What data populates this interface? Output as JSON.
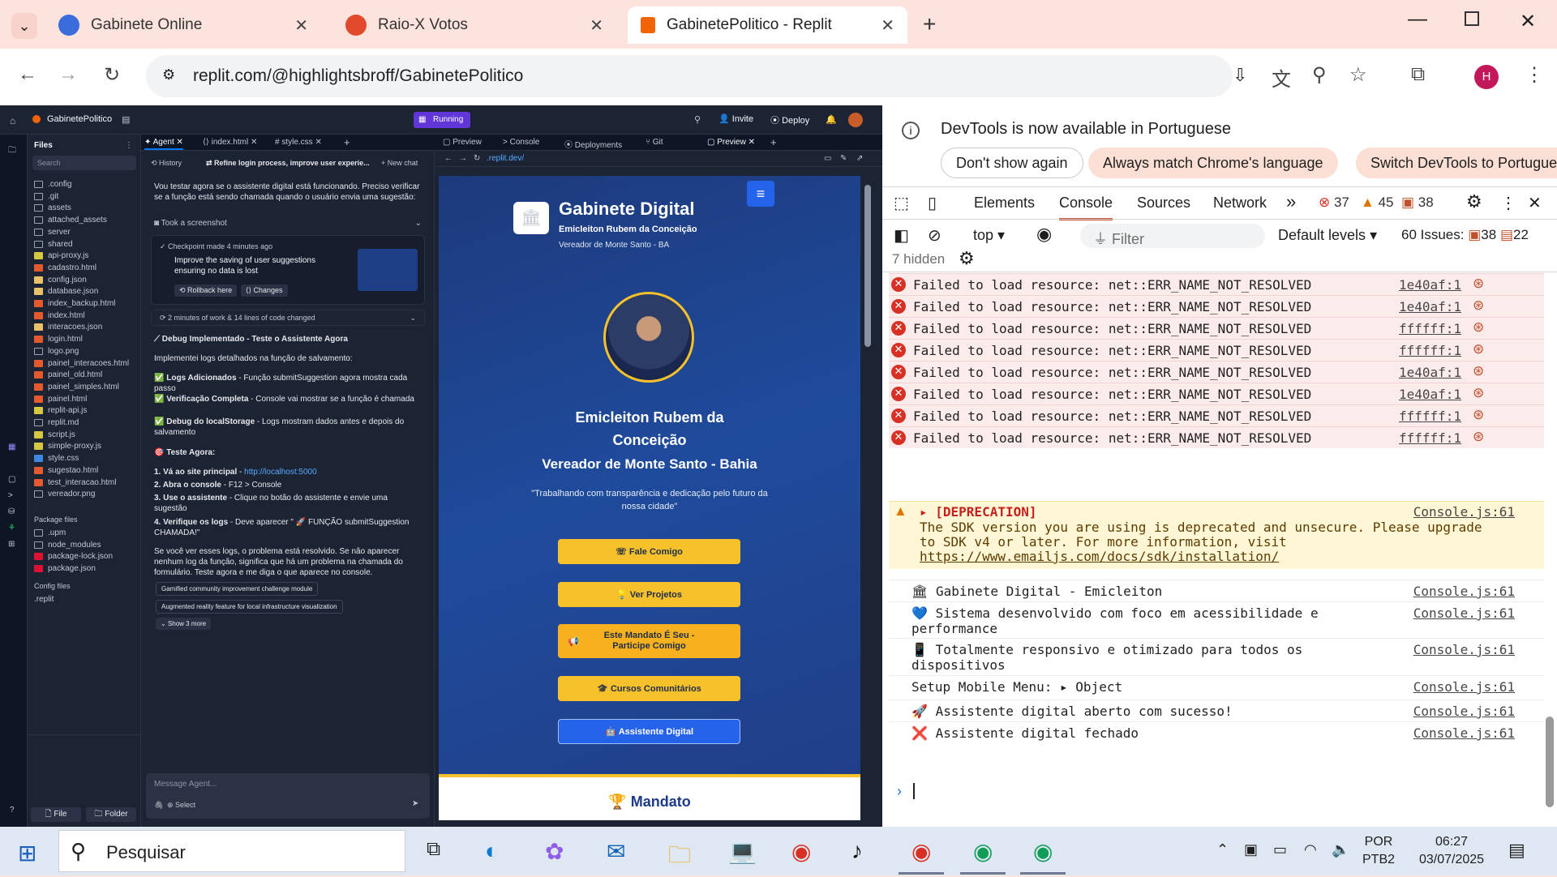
{
  "browser": {
    "tabs": [
      {
        "title": "Gabinete Online"
      },
      {
        "title": "Raio-X Votos"
      },
      {
        "title": "GabinetePolitico - Replit"
      }
    ],
    "url": "replit.com/@highlightsbroff/GabinetePolitico",
    "profile": "H"
  },
  "replit": {
    "project": "GabinetePolitico",
    "status": "Running",
    "invite": "Invite",
    "deploy": "Deploy",
    "files_title": "Files",
    "search": "Search",
    "files": [
      ".config",
      ".git",
      "assets",
      "attached_assets",
      "server",
      "shared",
      "api-proxy.js",
      "cadastro.html",
      "config.json",
      "database.json",
      "index_backup.html",
      "index.html",
      "interacoes.json",
      "login.html",
      "logo.png",
      "painel_interacoes.html",
      "painel_old.html",
      "painel_simples.html",
      "painel.html",
      "replit-api.js",
      "replit.md",
      "script.js",
      "simple-proxy.js",
      "style.css",
      "sugestao.html",
      "test_interacao.html",
      "vereador.png"
    ],
    "package_title": "Package files",
    "packages": [
      ".upm",
      "node_modules",
      "package-lock.json",
      "package.json"
    ],
    "config_title": "Config files",
    "configs": [
      ".replit"
    ],
    "file_btn": "File",
    "folder_btn": "Folder",
    "tabs_left": [
      "Agent",
      "index.html",
      "style.css"
    ],
    "tabs_right": [
      "Preview",
      "Console",
      "Deployments",
      "Git",
      "Preview"
    ],
    "history": "History",
    "task": "Refine login process, improve user experie...",
    "newchat": "New chat",
    "agent": {
      "intro": "Vou testar agora se o assistente digital está funcionando. Preciso verificar se a função está sendo chamada quando o usuário envia uma sugestão:",
      "screenshot": "Took a screenshot",
      "checkpoint": "Checkpoint made 4 minutes ago",
      "checkpoint_msg": "Improve the saving of user suggestions ensuring no data is lost",
      "rollback": "Rollback here",
      "changes": "Changes",
      "work": "2 minutes of work & 14 lines of code changed",
      "heading": "Debug Implementado - Teste o Assistente Agora",
      "p1": "Implementei logs detalhados na função de salvamento:",
      "b1t": "Logs Adicionados",
      "b1": " - Função submitSuggestion agora mostra cada passo",
      "b2t": "Verificação Completa",
      "b2": " - Console vai mostrar se a função é chamada",
      "b3t": "Debug do localStorage",
      "b3": " - Logs mostram dados antes e depois do salvamento",
      "test": "Teste Agora:",
      "s1t": "1. Vá ao site principal",
      "s1l": "http://localhost:5000",
      "s2t": "2. Abra o console",
      "s2": " - F12 > Console",
      "s3t": "3. Use o assistente",
      "s3": " - Clique no botão do assistente e envie uma sugestão",
      "s4t": "4. Verifique os logs",
      "s4": " - Deve aparecer \" 🚀 FUNÇÃO submitSuggestion CHAMADA!\"",
      "p2": "Se você ver esses logs, o problema está resolvido. Se não aparecer nenhum log da função, significa que há um problema na chamada do formulário. Teste agora e me diga o que aparece no console.",
      "chip1": "Gamified community improvement challenge module",
      "chip2": "Augmented reality feature for local infrastructure visualization",
      "more": "Show 3 more",
      "input": "Message Agent...",
      "select": "Select"
    }
  },
  "preview": {
    "url": ".replit.dev/",
    "site": {
      "title": "Gabinete Digital",
      "sub1": "Emicleiton Rubem da Conceição",
      "sub2": "Vereador de Monte Santo - BA",
      "name1": "Emicleiton Rubem da",
      "name2": "Conceição",
      "role": "Vereador de Monte Santo - Bahia",
      "quote": "\"Trabalhando com transparência e dedicação pelo futuro da nossa cidade\"",
      "btn1": "Fale Comigo",
      "btn2": "Ver Projetos",
      "btn3": "Este Mandato É Seu - Participe Comigo",
      "btn4": "Cursos Comunitários",
      "btn5": "Assistente Digital",
      "mandato": "Mandato"
    }
  },
  "devtools": {
    "banner": "DevTools is now available in Portuguese",
    "b1": "Don't show again",
    "b2": "Always match Chrome's language",
    "b3": "Switch DevTools to Portugue",
    "tabs": [
      "Elements",
      "Console",
      "Sources",
      "Network"
    ],
    "errors": "37",
    "warnings": "45",
    "infos": "38",
    "context": "top",
    "filter": "Filter",
    "levels": "Default levels",
    "issues_label": "60 Issues:",
    "issues_err": "38",
    "issues_info": "22",
    "hidden": "7 hidden",
    "errors_list": [
      {
        "msg": "Failed to load resource: net::ERR_NAME_NOT_RESOLVED",
        "src": "1e40af:1"
      },
      {
        "msg": "Failed to load resource: net::ERR_NAME_NOT_RESOLVED",
        "src": "1e40af:1"
      },
      {
        "msg": "Failed to load resource: net::ERR_NAME_NOT_RESOLVED",
        "src": "ffffff:1"
      },
      {
        "msg": "Failed to load resource: net::ERR_NAME_NOT_RESOLVED",
        "src": "ffffff:1"
      },
      {
        "msg": "Failed to load resource: net::ERR_NAME_NOT_RESOLVED",
        "src": "1e40af:1"
      },
      {
        "msg": "Failed to load resource: net::ERR_NAME_NOT_RESOLVED",
        "src": "1e40af:1"
      },
      {
        "msg": "Failed to load resource: net::ERR_NAME_NOT_RESOLVED",
        "src": "ffffff:1"
      },
      {
        "msg": "Failed to load resource: net::ERR_NAME_NOT_RESOLVED",
        "src": "ffffff:1"
      }
    ],
    "warn_tag": "[DEPRECATION]",
    "warn_l1": "The SDK version you are using is deprecated and unsecure. Please upgrade",
    "warn_l2": "to SDK v4 or later. For more information, visit",
    "warn_link": "https://www.emailjs.com/docs/sdk/installation/",
    "warn_src": "Console.js:61",
    "logs": [
      {
        "icon": "🏛",
        "l1": "Gabinete Digital - Emicleiton",
        "l2": "",
        "src": "Console.js:61"
      },
      {
        "icon": "💙",
        "l1": "Sistema desenvolvido com foco em acessibilidade e",
        "l2": "performance",
        "src": "Console.js:61"
      },
      {
        "icon": "📱",
        "l1": "Totalmente responsivo e otimizado para todos os",
        "l2": "dispositivos",
        "src": "Console.js:61"
      },
      {
        "icon": "",
        "l1": "Setup Mobile Menu: ▸ Object",
        "l2": "",
        "src": "Console.js:61"
      },
      {
        "icon": "🚀",
        "l1": "Assistente digital aberto com sucesso!",
        "l2": "",
        "src": "Console.js:61"
      },
      {
        "icon": "❌",
        "l1": "Assistente digital fechado",
        "l2": "",
        "src": "Console.js:61"
      }
    ]
  },
  "taskbar": {
    "search": "Pesquisar",
    "lang1": "POR",
    "lang2": "PTB2",
    "time": "06:27",
    "date": "03/07/2025"
  }
}
